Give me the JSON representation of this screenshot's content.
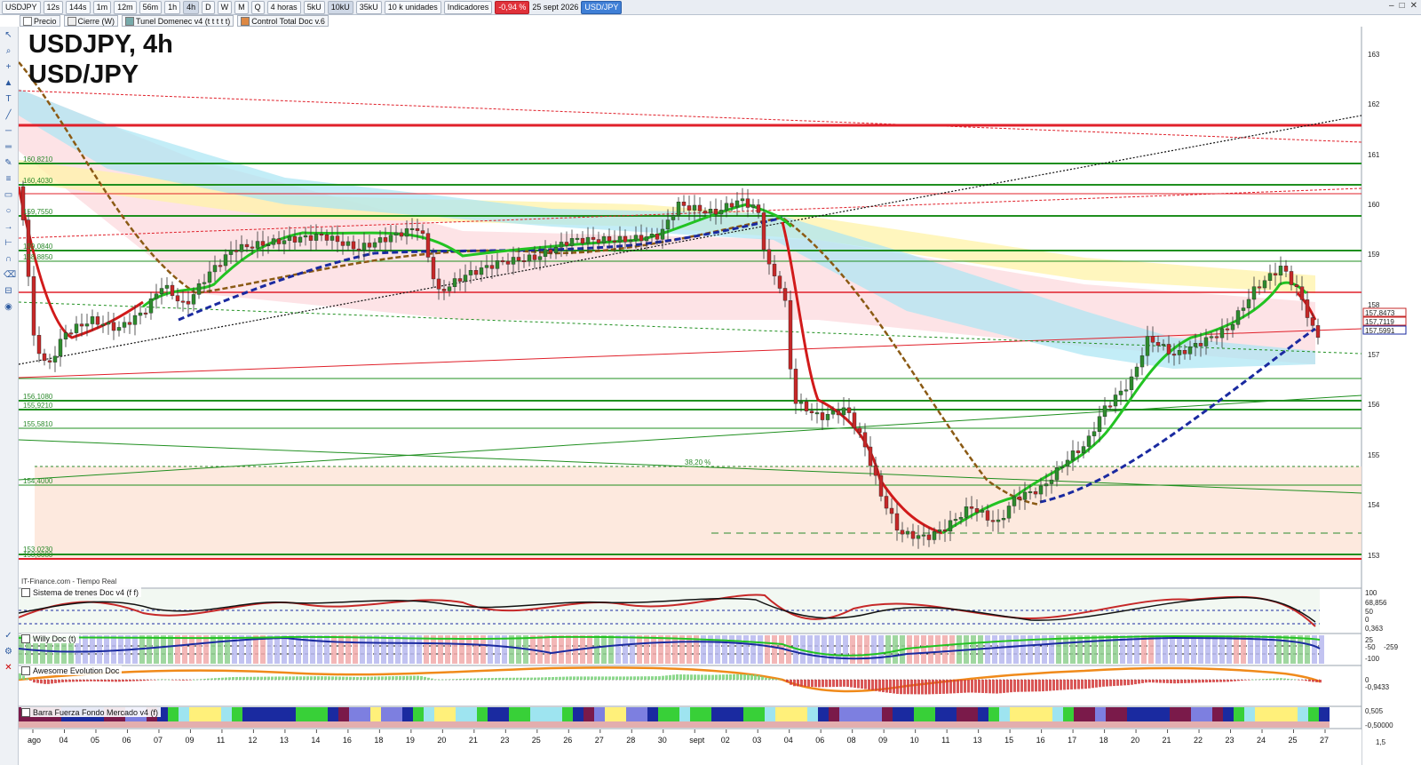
{
  "toolbar": {
    "symbol": "USDJPY",
    "timeframes": [
      "12s",
      "144s",
      "1m",
      "12m",
      "56m",
      "1h",
      "4h",
      "D",
      "W",
      "M",
      "Q"
    ],
    "active_timeframe": "4h",
    "period_select": "4 horas",
    "units": [
      "5kU",
      "10kU",
      "35kU"
    ],
    "units_select": "10 k unidades",
    "indicators_label": "Indicadores",
    "change_badge": "-0,94 %",
    "date": "25 sept 2026",
    "pair_badge": "USD/JPY"
  },
  "legend": {
    "items": [
      "Precio",
      "Cierre (W)",
      "Tunel Domenec v4 (t t t t t)",
      "Control Total Doc v.6"
    ]
  },
  "chart": {
    "title_line1": "USDJPY, 4h",
    "title_line2": "USD/JPY",
    "source": "IT-Finance.com - Tiempo Real",
    "fib_label": "38,20 %",
    "price_ticks": [
      "163",
      "162",
      "161",
      "160",
      "159",
      "158",
      "157",
      "156",
      "155",
      "154",
      "153"
    ],
    "price_tags": [
      "157,8473",
      "157,7119",
      "157,5991"
    ],
    "level_labels": [
      "160,8210",
      "160,4030",
      "159,7550",
      "159,0840",
      "158,8850",
      "156,1080",
      "155,9210",
      "155,5810",
      "154,4000",
      "153,0230",
      "153,0080"
    ],
    "date_ticks": [
      "ago",
      "04",
      "05",
      "06",
      "07",
      "09",
      "11",
      "12",
      "13",
      "14",
      "16",
      "18",
      "19",
      "20",
      "21",
      "23",
      "25",
      "26",
      "27",
      "28",
      "30",
      "sept",
      "02",
      "03",
      "04",
      "06",
      "08",
      "09",
      "10",
      "11",
      "13",
      "15",
      "16",
      "17",
      "18",
      "20",
      "21",
      "22",
      "23",
      "24",
      "25",
      "27"
    ],
    "colors": {
      "up_candle": "#2e8b2e",
      "down_candle": "#c62828",
      "tunnel_cyan": "#7fd7ee",
      "tunnel_yellow": "#fff07a",
      "tunnel_pink": "#f7b7bd",
      "support_green": "#1f8f1f",
      "resistance_red": "#e0202a",
      "ma_blue": "#1a2aa0",
      "ma_brown": "#8b5a14"
    }
  },
  "indicators": [
    {
      "name": "Sistema de trenes Doc v4 (f f)",
      "values": [
        "100",
        "68,856",
        "50",
        "0",
        "0,363"
      ]
    },
    {
      "name": "Willy Doc (t)",
      "values": [
        "25",
        "-50",
        "-259",
        "-100"
      ]
    },
    {
      "name": "Awesome Evolution Doc",
      "values": [
        "0",
        "-0,9433"
      ]
    },
    {
      "name": "Barra Fuerza Fondo Mercado v4 (f)",
      "values": [
        "0,505",
        "-0,50000"
      ]
    }
  ],
  "footer": {
    "scale_value": "1,5"
  }
}
